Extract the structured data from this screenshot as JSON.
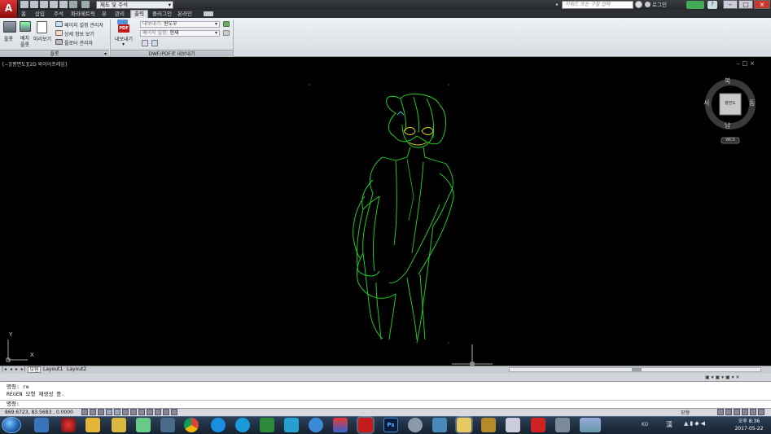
{
  "window": {
    "workspace": "제도 및 주석",
    "search_placeholder": "키워드 또는 구절 입력",
    "login": "로그인",
    "minimize": "–",
    "maximize": "□",
    "close": "×"
  },
  "ribbon_tabs": [
    "홈",
    "삽입",
    "주석",
    "파라메트릭",
    "뷰",
    "관리",
    "출력",
    "플러그인",
    "온라인"
  ],
  "active_tab": "출력",
  "ribbon": {
    "plot_panel": {
      "plot": "플롯",
      "batch_plot_1": "배치",
      "batch_plot_2": "플롯",
      "preview": "미리보기",
      "page_setup": "페이지 설정 관리자",
      "plot_details": "상세 정보 보기",
      "plotter_manager": "플로터 관리자",
      "title": "플롯"
    },
    "export_panel": {
      "export": "내보내기",
      "export_label": "내보내기:",
      "export_value": "윈도우",
      "page_setup_label": "페이지 설정:",
      "page_setup_value": "현재",
      "title": "DWF/PDF로 내보내기",
      "pdf_badge": "PDF"
    }
  },
  "viewport": {
    "label": "[−][평면도][2D 와이어프레임]",
    "controls": "–□×",
    "viewcube": {
      "north": "북",
      "south": "남",
      "east": "동",
      "west": "서",
      "face": "평면도",
      "wcs": "WCS"
    },
    "ucs": {
      "x": "X",
      "y": "Y"
    }
  },
  "layout_tabs": [
    "모형",
    "Layout1",
    "Layout2"
  ],
  "command": {
    "history": [
      "명령: re",
      "REGEN 모형 재생성 중."
    ],
    "prompt": "명령:"
  },
  "status": {
    "coords": "869.6723, 83.5683 , 0.0000",
    "model": "모형"
  },
  "taskbar": {
    "time": "오후 8:36",
    "date": "2017-05-22",
    "ime": "KO",
    "hanja": "漢",
    "ps_label": "Ps"
  },
  "colors": {
    "accent_red": "#c41a1a",
    "drawing_green": "#22dd22",
    "drawing_yellow": "#e6e61a",
    "drawing_cyan": "#30d0e0"
  }
}
